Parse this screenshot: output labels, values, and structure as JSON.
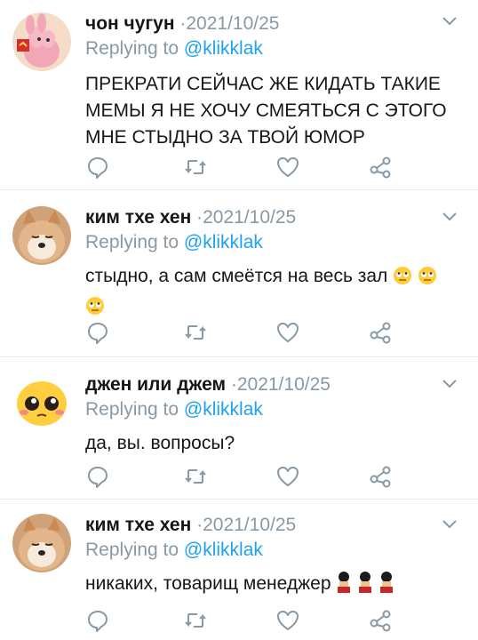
{
  "tweets": [
    {
      "name": "чон чугун",
      "date": "2021/10/25",
      "replying_prefix": "Replying to ",
      "replying_handle": "@klikklak",
      "text": "ПРЕКРАТИ СЕЙЧАС ЖЕ КИДАТЬ ТАКИЕ МЕМЫ Я НЕ ХОЧУ СМЕЯТЬСЯ С ЭТОГО МНЕ СТЫДНО ЗА ТВОЙ ЮМОР",
      "avatar": "pink-cartoon-character-avatar"
    },
    {
      "name": "ким тхе хен",
      "date": "2021/10/25",
      "replying_prefix": "Replying to ",
      "replying_handle": "@klikklak",
      "text": "стыдно, а сам смеётся на весь зал",
      "emoji": "rolling-eyes-emoji",
      "emoji_count": 3,
      "avatar": "shiba-dog-avatar"
    },
    {
      "name": "джен или джем",
      "date": "2021/10/25",
      "replying_prefix": "Replying to ",
      "replying_handle": "@klikklak",
      "text": "да, вы. вопросы?",
      "avatar": "pleading-face-avatar"
    },
    {
      "name": "ким тхе хен",
      "date": "2021/10/25",
      "replying_prefix": "Replying to ",
      "replying_handle": "@klikklak",
      "text": "никаких, товарищ менеджер",
      "emoji": "guard-emoji",
      "emoji_count": 3,
      "avatar": "shiba-dog-avatar"
    }
  ],
  "meta": {
    "date_separator": " ·"
  },
  "colors": {
    "text": "#14171a",
    "muted": "#8899a6",
    "link": "#1da1f2",
    "divider": "#e6ecf0"
  },
  "icons": [
    "reply-icon",
    "retweet-icon",
    "like-icon",
    "share-icon",
    "chevron-down-icon"
  ]
}
